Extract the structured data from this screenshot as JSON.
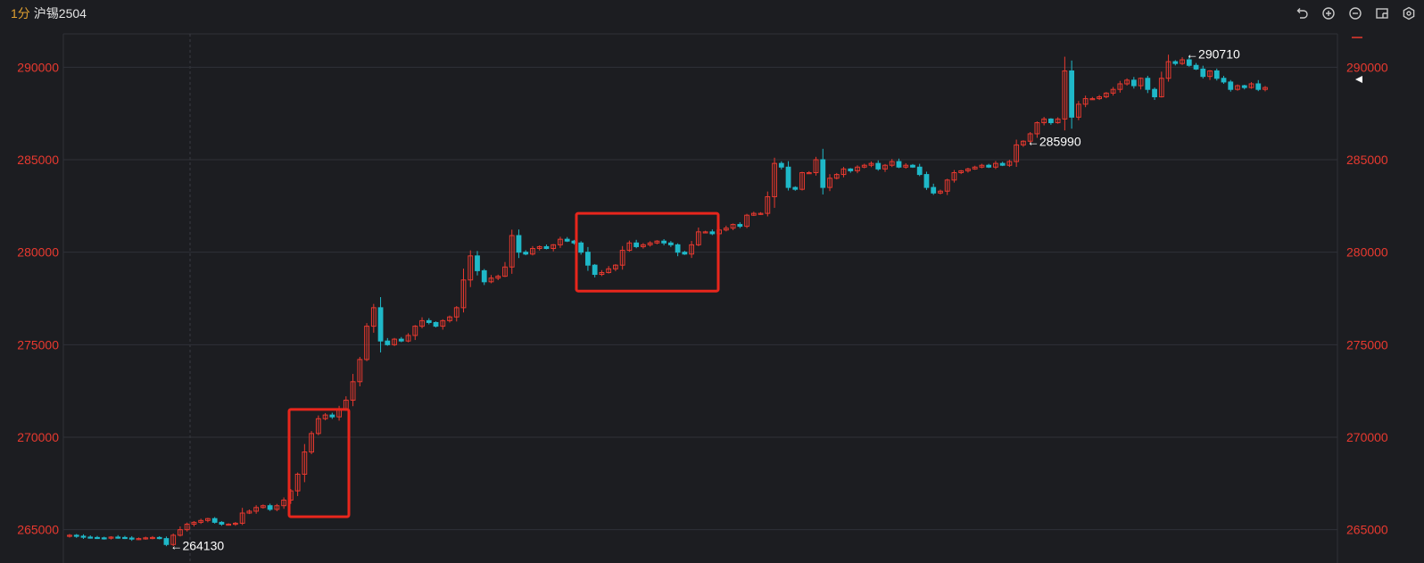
{
  "header": {
    "period": "1分",
    "symbol": "沪锡2504"
  },
  "toolbar": {
    "icons": [
      "undo-icon",
      "zoom-in-icon",
      "zoom-out-icon",
      "layout-icon",
      "settings-icon"
    ]
  },
  "colors": {
    "background": "#1c1d21",
    "grid": "#2f3138",
    "up": "#e8392f",
    "down": "#1fb8c8",
    "axis_text": "#e8392f",
    "annotation_text": "#ffffff",
    "highlight_box": "#e8261c"
  },
  "chart_data": {
    "type": "candlestick",
    "yticks": [
      265000,
      270000,
      275000,
      280000,
      285000,
      290000
    ],
    "ytick_labels": [
      "265000",
      "270000",
      "275000",
      "280000",
      "285000",
      "290000"
    ],
    "ylim": [
      263200,
      291800
    ],
    "grid": true,
    "annotations": [
      {
        "text": "←264130",
        "value": 264130
      },
      {
        "text": "←285990",
        "value": 285990
      },
      {
        "text": "←290710",
        "value": 290710
      }
    ],
    "highlight_boxes": [
      {
        "from_value": 265700,
        "to_value": 271500
      },
      {
        "from_value": 277900,
        "to_value": 282100
      }
    ],
    "price_path": [
      264700,
      264650,
      264600,
      264580,
      264560,
      264540,
      264600,
      264580,
      264550,
      264500,
      264520,
      264560,
      264580,
      264520,
      264200,
      264700,
      265000,
      265300,
      265400,
      265500,
      265600,
      265400,
      265300,
      265300,
      265350,
      265900,
      266000,
      266200,
      266300,
      266100,
      266300,
      266600,
      267100,
      268000,
      269200,
      270200,
      271000,
      271200,
      271100,
      271500,
      272000,
      273000,
      274200,
      276000,
      277000,
      275200,
      275000,
      275300,
      275200,
      275500,
      276000,
      276300,
      276200,
      276000,
      276300,
      276500,
      277000,
      278500,
      279800,
      279000,
      278400,
      278600,
      278700,
      279200,
      280900,
      280000,
      279900,
      280200,
      280300,
      280200,
      280400,
      280700,
      280600,
      280500,
      280000,
      279300,
      278800,
      278900,
      279100,
      279300,
      280100,
      280500,
      280300,
      280400,
      280500,
      280600,
      280500,
      280400,
      280000,
      279900,
      280400,
      281100,
      281100,
      281000,
      281200,
      281300,
      281500,
      281400,
      282000,
      282100,
      282100,
      283000,
      284800,
      284600,
      283500,
      283400,
      284300,
      284300,
      285000,
      283500,
      284000,
      284200,
      284500,
      284400,
      284600,
      284700,
      284800,
      284500,
      284700,
      284900,
      284600,
      284700,
      284600,
      284200,
      283500,
      283200,
      283300,
      283900,
      284300,
      284400,
      284500,
      284600,
      284700,
      284600,
      284800,
      284700,
      284900,
      285800,
      286000,
      286400,
      287000,
      287200,
      287000,
      287200,
      289800,
      287300,
      288000,
      288300,
      288300,
      288400,
      288600,
      288800,
      289100,
      289300,
      289000,
      289400,
      288800,
      288400,
      289400,
      290300,
      290200,
      290400,
      290100,
      289900,
      289500,
      289800,
      289400,
      289200,
      288800,
      289000,
      288900,
      289100,
      288800,
      288900
    ]
  }
}
